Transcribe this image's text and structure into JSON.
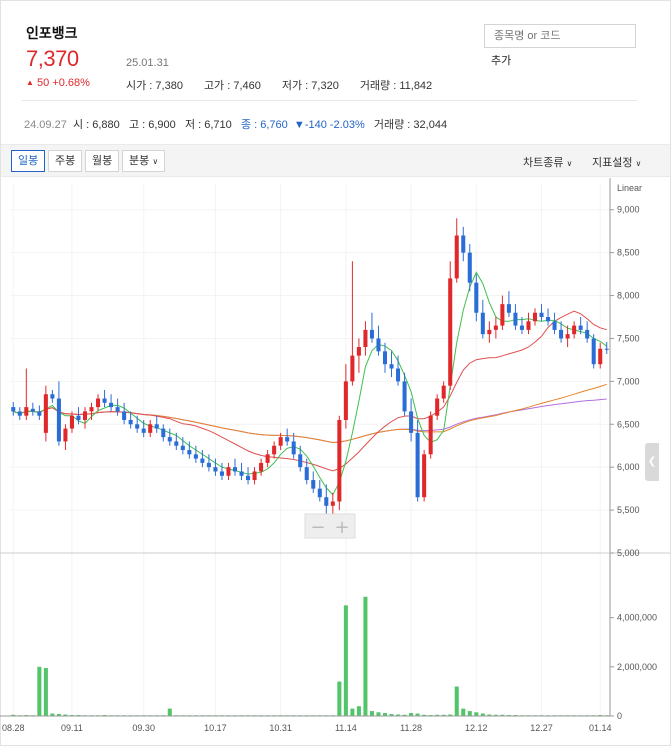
{
  "stock": {
    "name": "인포뱅크",
    "price": "7,370",
    "date": "25.01.31",
    "change_arrow": "▲",
    "change": "50 +0.68%",
    "open": "시가 : 7,380",
    "high": "고가 : 7,460",
    "low": "저가 : 7,320",
    "volume": "거래량 : 11,842"
  },
  "search": {
    "placeholder": "종목명 or 코드",
    "add_label": "추가"
  },
  "info_bar": {
    "date": "24.09.27",
    "open": "시 : 6,880",
    "high": "고 : 6,900",
    "low": "저 : 6,710",
    "close": "종 : 6,760",
    "change": "▼-140 -2.03%",
    "volume": "거래량 : 32,044"
  },
  "toolbar": {
    "periods": [
      "일봉",
      "주봉",
      "월봉",
      "분봉"
    ],
    "active_period": "일봉",
    "chart_type": "차트종류",
    "indicator": "지표설정"
  },
  "zoom": {
    "minus": "−",
    "plus": "+"
  },
  "colors": {
    "up": "#e0282b",
    "down": "#2a6dd6",
    "ma5": "#3fbf4f",
    "ma20": "#e05050",
    "ma60": "#e6862a",
    "ma120": "#b26fe0",
    "volume": "#52c46a"
  },
  "chart_data": {
    "type": "candlestick",
    "scale": "Linear",
    "ylim": [
      5000,
      9300
    ],
    "yticks": [
      "9,000",
      "8,500",
      "8,000",
      "7,500",
      "7,000",
      "6,500",
      "6,000",
      "5,500",
      "5,000"
    ],
    "volume_ticks": [
      "4,000,000",
      "2,000,000",
      "0"
    ],
    "volume_max": 4800000,
    "xticks": [
      {
        "label": "08.28",
        "i": 0
      },
      {
        "label": "09.11",
        "i": 9
      },
      {
        "label": "09.30",
        "i": 20
      },
      {
        "label": "10.17",
        "i": 31
      },
      {
        "label": "10.31",
        "i": 41
      },
      {
        "label": "11.14",
        "i": 51
      },
      {
        "label": "11.28",
        "i": 61
      },
      {
        "label": "12.12",
        "i": 71
      },
      {
        "label": "12.27",
        "i": 81
      },
      {
        "label": "01.14",
        "i": 90
      }
    ],
    "candles": [
      [
        6700,
        6760,
        6600,
        6650
      ],
      [
        6650,
        6700,
        6550,
        6600
      ],
      [
        6600,
        7150,
        6550,
        6700
      ],
      [
        6680,
        6750,
        6600,
        6650
      ],
      [
        6650,
        6720,
        6550,
        6600
      ],
      [
        6400,
        6950,
        6300,
        6850
      ],
      [
        6850,
        6900,
        6750,
        6800
      ],
      [
        6800,
        7000,
        6250,
        6300
      ],
      [
        6300,
        6500,
        6200,
        6450
      ],
      [
        6450,
        6650,
        6400,
        6600
      ],
      [
        6600,
        6700,
        6500,
        6550
      ],
      [
        6550,
        6700,
        6450,
        6650
      ],
      [
        6650,
        6750,
        6550,
        6700
      ],
      [
        6700,
        6850,
        6650,
        6800
      ],
      [
        6800,
        6900,
        6700,
        6750
      ],
      [
        6750,
        6850,
        6650,
        6700
      ],
      [
        6700,
        6800,
        6600,
        6650
      ],
      [
        6650,
        6750,
        6500,
        6550
      ],
      [
        6550,
        6650,
        6450,
        6500
      ],
      [
        6500,
        6600,
        6400,
        6450
      ],
      [
        6450,
        6550,
        6350,
        6400
      ],
      [
        6400,
        6550,
        6350,
        6500
      ],
      [
        6500,
        6600,
        6400,
        6450
      ],
      [
        6450,
        6500,
        6300,
        6350
      ],
      [
        6350,
        6450,
        6250,
        6300
      ],
      [
        6300,
        6400,
        6200,
        6250
      ],
      [
        6250,
        6350,
        6150,
        6200
      ],
      [
        6200,
        6300,
        6100,
        6150
      ],
      [
        6150,
        6250,
        6050,
        6100
      ],
      [
        6100,
        6200,
        6000,
        6050
      ],
      [
        6050,
        6150,
        5950,
        6000
      ],
      [
        6000,
        6100,
        5900,
        5950
      ],
      [
        5950,
        6050,
        5850,
        5900
      ],
      [
        5900,
        6050,
        5850,
        6000
      ],
      [
        6000,
        6100,
        5900,
        5950
      ],
      [
        5950,
        6050,
        5850,
        5900
      ],
      [
        5900,
        6000,
        5800,
        5850
      ],
      [
        5850,
        6000,
        5800,
        5950
      ],
      [
        5950,
        6100,
        5900,
        6050
      ],
      [
        6050,
        6200,
        6000,
        6150
      ],
      [
        6150,
        6300,
        6100,
        6250
      ],
      [
        6250,
        6400,
        6200,
        6350
      ],
      [
        6350,
        6450,
        6250,
        6300
      ],
      [
        6300,
        6400,
        6100,
        6150
      ],
      [
        6150,
        6250,
        5950,
        6000
      ],
      [
        6000,
        6100,
        5800,
        5850
      ],
      [
        5850,
        5950,
        5700,
        5750
      ],
      [
        5750,
        5850,
        5600,
        5650
      ],
      [
        5650,
        5800,
        5450,
        5550
      ],
      [
        5550,
        5700,
        5400,
        5600
      ],
      [
        5600,
        6600,
        5500,
        6550
      ],
      [
        6550,
        7200,
        6450,
        7000
      ],
      [
        7000,
        8400,
        6950,
        7300
      ],
      [
        7300,
        7500,
        7100,
        7400
      ],
      [
        7400,
        7700,
        7300,
        7600
      ],
      [
        7600,
        7800,
        7450,
        7500
      ],
      [
        7500,
        7650,
        7300,
        7350
      ],
      [
        7350,
        7450,
        7100,
        7200
      ],
      [
        7200,
        7350,
        7050,
        7150
      ],
      [
        7150,
        7300,
        6950,
        7000
      ],
      [
        7000,
        7100,
        6600,
        6650
      ],
      [
        6650,
        6800,
        6300,
        6400
      ],
      [
        6400,
        6550,
        5600,
        5650
      ],
      [
        5650,
        6200,
        5600,
        6150
      ],
      [
        6150,
        6650,
        6100,
        6600
      ],
      [
        6600,
        6850,
        6550,
        6800
      ],
      [
        6800,
        7000,
        6750,
        6950
      ],
      [
        6950,
        8400,
        6900,
        8200
      ],
      [
        8200,
        8900,
        8150,
        8700
      ],
      [
        8700,
        8800,
        8400,
        8500
      ],
      [
        8500,
        8600,
        8050,
        8150
      ],
      [
        8150,
        8250,
        7700,
        7800
      ],
      [
        7800,
        7950,
        7500,
        7550
      ],
      [
        7550,
        7700,
        7450,
        7600
      ],
      [
        7600,
        7750,
        7500,
        7650
      ],
      [
        7650,
        8000,
        7600,
        7900
      ],
      [
        7900,
        8050,
        7750,
        7800
      ],
      [
        7800,
        7900,
        7600,
        7650
      ],
      [
        7650,
        7750,
        7550,
        7600
      ],
      [
        7600,
        7800,
        7550,
        7700
      ],
      [
        7700,
        7850,
        7650,
        7800
      ],
      [
        7800,
        7900,
        7700,
        7750
      ],
      [
        7750,
        7850,
        7650,
        7700
      ],
      [
        7700,
        7800,
        7550,
        7600
      ],
      [
        7600,
        7700,
        7450,
        7500
      ],
      [
        7500,
        7650,
        7400,
        7550
      ],
      [
        7550,
        7700,
        7500,
        7650
      ],
      [
        7650,
        7750,
        7550,
        7600
      ],
      [
        7600,
        7700,
        7450,
        7500
      ],
      [
        7500,
        7550,
        7150,
        7200
      ],
      [
        7200,
        7450,
        7150,
        7380
      ],
      [
        7380,
        7460,
        7320,
        7370
      ]
    ],
    "volume": [
      50000,
      30000,
      40000,
      30000,
      2000000,
      1950000,
      100000,
      80000,
      60000,
      40000,
      40000,
      30000,
      30000,
      30000,
      40000,
      30000,
      30000,
      30000,
      30000,
      30000,
      30000,
      30000,
      30000,
      30000,
      300000,
      30000,
      30000,
      30000,
      30000,
      30000,
      30000,
      30000,
      30000,
      30000,
      30000,
      30000,
      30000,
      30000,
      30000,
      30000,
      30000,
      30000,
      30000,
      30000,
      30000,
      30000,
      30000,
      30000,
      30000,
      30000,
      1400000,
      4500000,
      300000,
      400000,
      4850000,
      200000,
      150000,
      120000,
      80000,
      60000,
      50000,
      120000,
      100000,
      50000,
      40000,
      50000,
      50000,
      60000,
      1200000,
      300000,
      200000,
      150000,
      100000,
      60000,
      50000,
      50000,
      40000,
      40000,
      30000,
      30000,
      30000,
      30000,
      30000,
      30000,
      30000,
      30000,
      30000,
      30000,
      30000,
      30000,
      40000,
      30000
    ]
  }
}
